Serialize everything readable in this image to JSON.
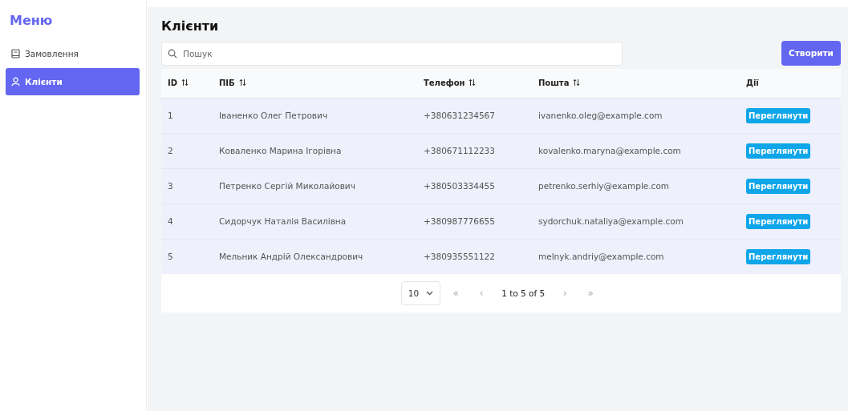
{
  "sidebar": {
    "title": "Меню",
    "items": [
      {
        "label": "Замовлення",
        "selected": false
      },
      {
        "label": "Клієнти",
        "selected": true
      }
    ]
  },
  "page": {
    "title": "Клієнти"
  },
  "search": {
    "placeholder": "Пошук"
  },
  "create_button": "Створити",
  "table": {
    "columns": [
      {
        "label": "ID",
        "sortable": true
      },
      {
        "label": "ПІБ",
        "sortable": true
      },
      {
        "label": "Телефон",
        "sortable": true
      },
      {
        "label": "Пошта",
        "sortable": true
      },
      {
        "label": "Дії",
        "sortable": false
      }
    ],
    "rows": [
      {
        "id": "1",
        "name": "Іваненко Олег Петрович",
        "phone": "+380631234567",
        "email": "ivanenko.oleg@example.com",
        "action": "Переглянути"
      },
      {
        "id": "2",
        "name": "Коваленко Марина Ігорівна",
        "phone": "+380671112233",
        "email": "kovalenko.maryna@example.com",
        "action": "Переглянути"
      },
      {
        "id": "3",
        "name": "Петренко Сергій Миколайович",
        "phone": "+380503334455",
        "email": "petrenko.serhiy@example.com",
        "action": "Переглянути"
      },
      {
        "id": "4",
        "name": "Сидорчук Наталія Василівна",
        "phone": "+380987776655",
        "email": "sydorchuk.nataliya@example.com",
        "action": "Переглянути"
      },
      {
        "id": "5",
        "name": "Мельник Андрій Олександрович",
        "phone": "+380935551122",
        "email": "melnyk.andriy@example.com",
        "action": "Переглянути"
      }
    ]
  },
  "pagination": {
    "page_size": "10",
    "first": "«",
    "prev": "‹",
    "range": "1 to 5 of 5",
    "next": "›",
    "last": "»"
  }
}
